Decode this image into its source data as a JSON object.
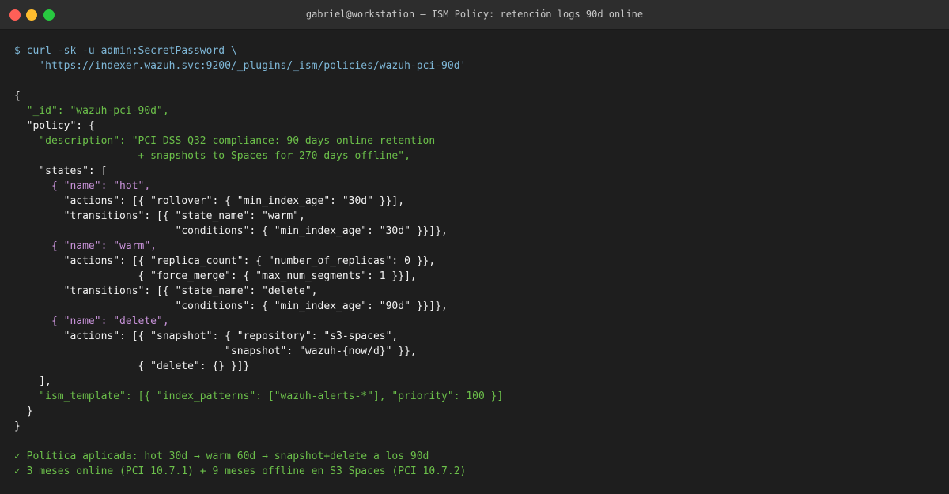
{
  "window": {
    "title": "gabriel@workstation — ISM Policy: retención logs 90d online"
  },
  "terminal": {
    "lines": [
      {
        "text": "$ curl -sk -u admin:SecretPassword \\",
        "kind": "cmd"
      },
      {
        "text": "    'https://indexer.wazuh.svc:9200/_plugins/_ism/policies/wazuh-pci-90d'",
        "kind": "cmd"
      },
      {
        "text": "",
        "kind": "white"
      },
      {
        "text": "{",
        "kind": "white"
      },
      {
        "text": "  \"_id\": \"wazuh-pci-90d\",",
        "kind": "str"
      },
      {
        "text": "  \"policy\": {",
        "kind": "white"
      },
      {
        "text": "    \"description\": \"PCI DSS Q32 compliance: 90 days online retention",
        "kind": "str"
      },
      {
        "text": "                    + snapshots to Spaces for 270 days offline\",",
        "kind": "str"
      },
      {
        "text": "    \"states\": [",
        "kind": "white"
      },
      {
        "text": "      { \"name\": \"hot\",",
        "kind": "purple"
      },
      {
        "text": "        \"actions\": [{ \"rollover\": { \"min_index_age\": \"30d\" }}],",
        "kind": "white"
      },
      {
        "text": "        \"transitions\": [{ \"state_name\": \"warm\",",
        "kind": "white"
      },
      {
        "text": "                          \"conditions\": { \"min_index_age\": \"30d\" }}]},",
        "kind": "white"
      },
      {
        "text": "      { \"name\": \"warm\",",
        "kind": "purple"
      },
      {
        "text": "        \"actions\": [{ \"replica_count\": { \"number_of_replicas\": 0 }},",
        "kind": "white"
      },
      {
        "text": "                    { \"force_merge\": { \"max_num_segments\": 1 }}],",
        "kind": "white"
      },
      {
        "text": "        \"transitions\": [{ \"state_name\": \"delete\",",
        "kind": "white"
      },
      {
        "text": "                          \"conditions\": { \"min_index_age\": \"90d\" }}]},",
        "kind": "white"
      },
      {
        "text": "      { \"name\": \"delete\",",
        "kind": "purple"
      },
      {
        "text": "        \"actions\": [{ \"snapshot\": { \"repository\": \"s3-spaces\",",
        "kind": "white"
      },
      {
        "text": "                                  \"snapshot\": \"wazuh-{now/d}\" }},",
        "kind": "white"
      },
      {
        "text": "                    { \"delete\": {} }]}",
        "kind": "white"
      },
      {
        "text": "    ],",
        "kind": "white"
      },
      {
        "text": "    \"ism_template\": [{ \"index_patterns\": [\"wazuh-alerts-*\"], \"priority\": 100 }]",
        "kind": "str"
      },
      {
        "text": "  }",
        "kind": "white"
      },
      {
        "text": "}",
        "kind": "white"
      },
      {
        "text": "",
        "kind": "white"
      },
      {
        "text": "✓ Política aplicada: hot 30d → warm 60d → snapshot+delete a los 90d",
        "kind": "str"
      },
      {
        "text": "✓ 3 meses online (PCI 10.7.1) + 9 meses offline en S3 Spaces (PCI 10.7.2)",
        "kind": "str"
      }
    ]
  },
  "colors": {
    "background": "#1e1e1e",
    "titlebar": "#2d2d2d",
    "command": "#7fb8d8",
    "string": "#6cc04a",
    "state_name": "#c792d8",
    "text": "#f2f2f2",
    "close": "#ff5f57",
    "minimize": "#febc2e",
    "maximize": "#28c840"
  }
}
